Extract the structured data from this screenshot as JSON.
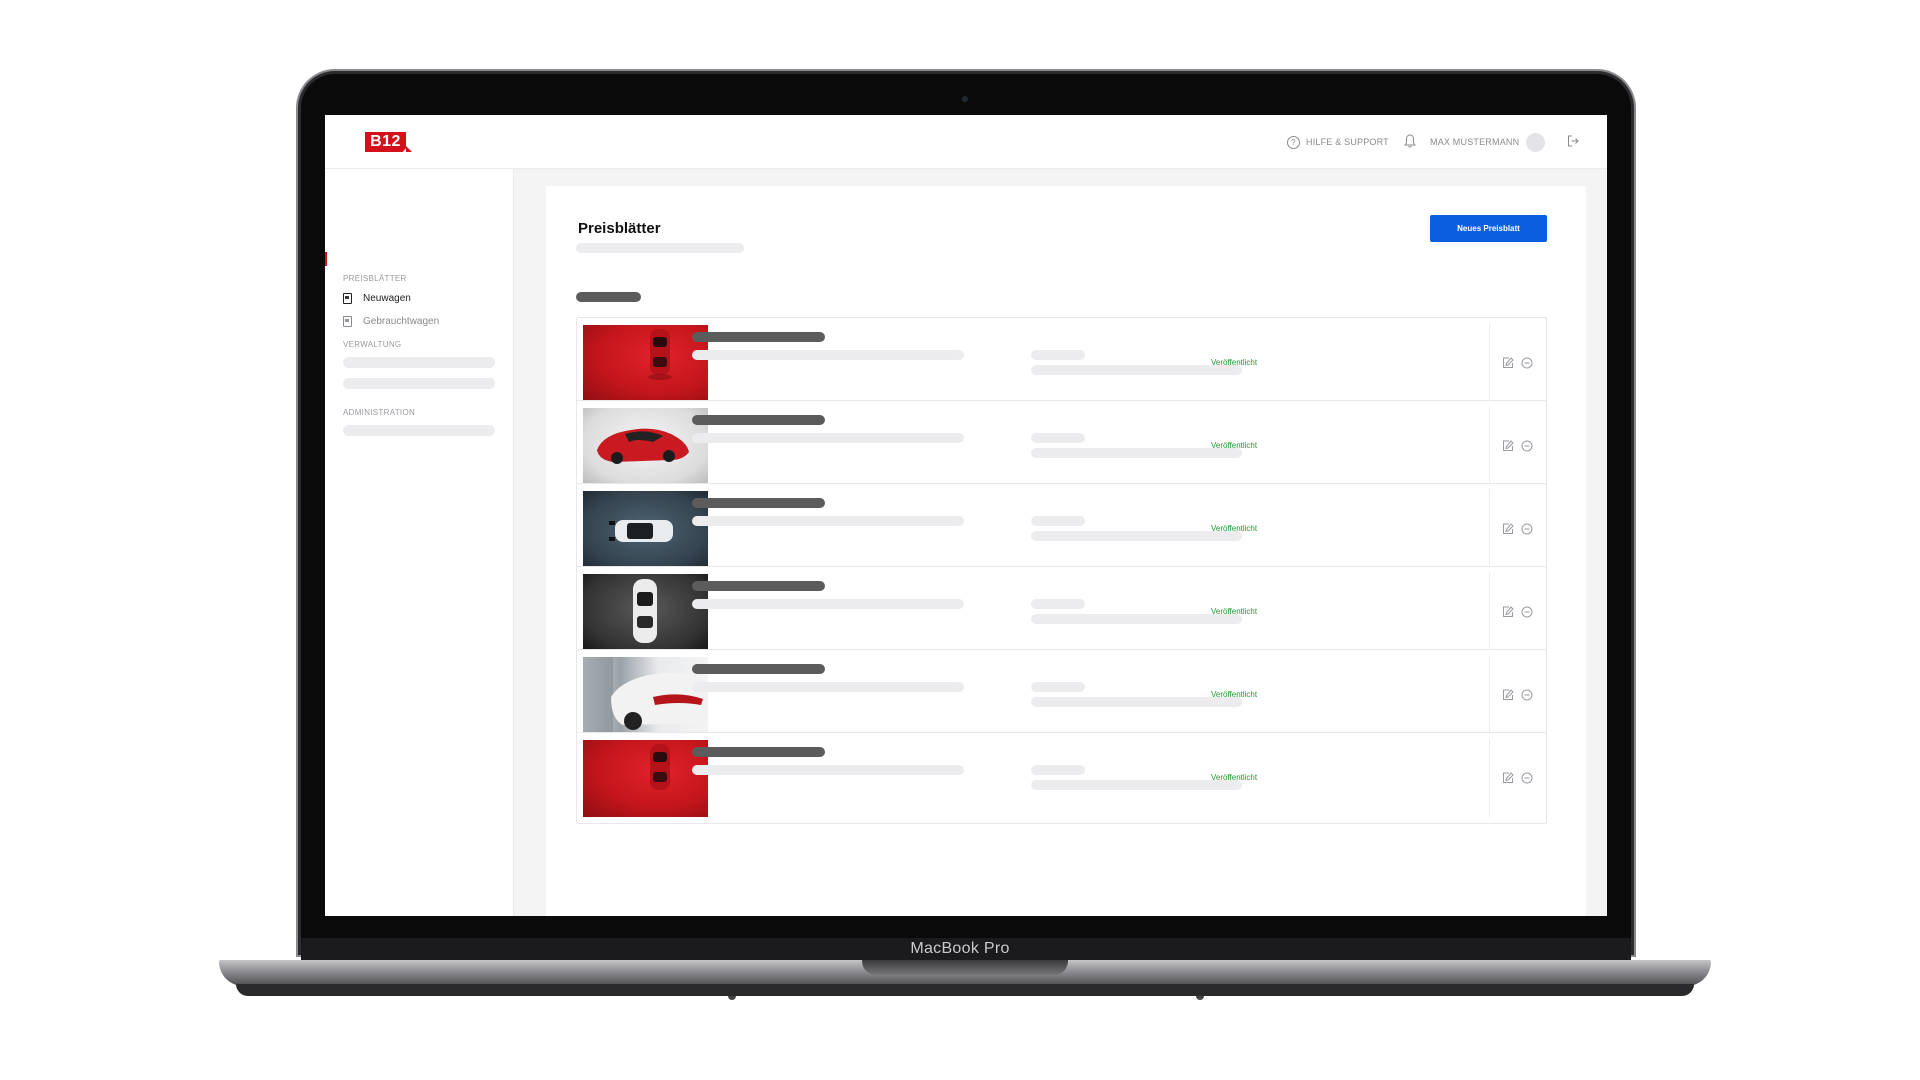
{
  "device": {
    "label": "MacBook Pro"
  },
  "topbar": {
    "logo": "B12",
    "help_label": "HILFE & SUPPORT",
    "help_icon": "?",
    "user_name": "MAX MUSTERMANN"
  },
  "sidebar": {
    "section_1": "PREISBLÄTTER",
    "items": [
      {
        "label": "Neuwagen"
      },
      {
        "label": "Gebrauchtwagen"
      }
    ],
    "section_2": "VERWALTUNG",
    "section_3": "ADMINISTRATION"
  },
  "main": {
    "title": "Preisblätter",
    "new_button": "Neues Preisblatt",
    "rows": [
      {
        "status": "Veröffentlicht",
        "image": "red-car-top"
      },
      {
        "status": "Veröffentlicht",
        "image": "red-car-angle"
      },
      {
        "status": "Veröffentlicht",
        "image": "white-suv-top"
      },
      {
        "status": "Veröffentlicht",
        "image": "white-car-dark-top"
      },
      {
        "status": "Veröffentlicht",
        "image": "white-car-showroom"
      },
      {
        "status": "Veröffentlicht",
        "image": "red-car-top"
      }
    ]
  },
  "colors": {
    "brand_red": "#d4111b",
    "primary_blue": "#0a5fe0",
    "status_green": "#1c9b34"
  }
}
